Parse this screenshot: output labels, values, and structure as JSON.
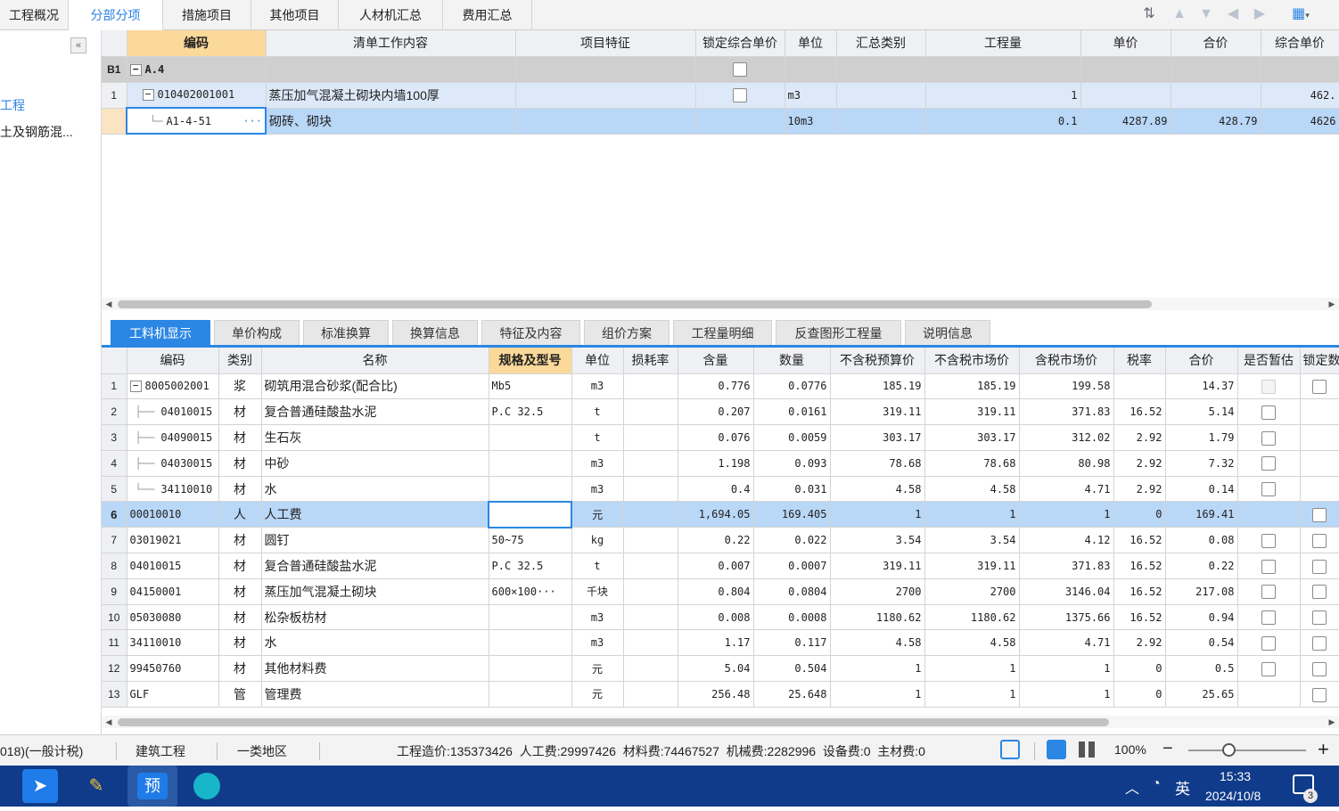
{
  "top_tabs": [
    "工程概况",
    "分部分项",
    "措施项目",
    "其他项目",
    "人材机汇总",
    "费用汇总"
  ],
  "active_top_tab": 1,
  "left_panel": {
    "items": [
      "工程",
      "土及钢筋混..."
    ]
  },
  "upper": {
    "headers": [
      "编码",
      "清单工作内容",
      "项目特征",
      "锁定综合单价",
      "单位",
      "汇总类别",
      "工程量",
      "单价",
      "合价",
      "综合单价"
    ],
    "rows": [
      {
        "num": "B1",
        "code": "A.4",
        "name": "",
        "feature": "",
        "lock": true,
        "unit": "",
        "cat": "",
        "qty": "",
        "price": "",
        "total": "",
        "comp": ""
      },
      {
        "num": "1",
        "code": "010402001001",
        "name": "蒸压加气混凝土砌块内墙100厚",
        "feature": "",
        "lock": true,
        "unit": "m3",
        "cat": "",
        "qty": "1",
        "price": "",
        "total": "",
        "comp": "462."
      },
      {
        "num": "",
        "code": "A1-4-51",
        "name": "砌砖、砌块",
        "feature": "",
        "lock": false,
        "unit": "10m3",
        "cat": "",
        "qty": "0.1",
        "price": "4287.89",
        "total": "428.79",
        "comp": "4626"
      }
    ],
    "ellipsis": "···"
  },
  "lower_tabs": [
    "工料机显示",
    "单价构成",
    "标准换算",
    "换算信息",
    "特征及内容",
    "组价方案",
    "工程量明细",
    "反查图形工程量",
    "说明信息"
  ],
  "active_lower_tab": 0,
  "lower": {
    "headers": [
      "编码",
      "类别",
      "名称",
      "规格及型号",
      "单位",
      "损耗率",
      "含量",
      "数量",
      "不含税预算价",
      "不含税市场价",
      "含税市场价",
      "税率",
      "合价",
      "是否暂估",
      "锁定数"
    ],
    "rows": [
      {
        "num": "1",
        "code": "8005002001",
        "type": "浆",
        "name": "砌筑用混合砂浆(配合比)",
        "spec": "Mb5",
        "unit": "m3",
        "loss": "",
        "content": "0.776",
        "qty": "0.0776",
        "p1": "185.19",
        "p2": "185.19",
        "p3": "199.58",
        "tax": "",
        "total": "14.37",
        "est": "dis",
        "lock": true
      },
      {
        "num": "2",
        "code": "04010015",
        "type": "材",
        "name": "复合普通硅酸盐水泥",
        "spec": "P.C 32.5",
        "unit": "t",
        "loss": "",
        "content": "0.207",
        "qty": "0.0161",
        "p1": "319.11",
        "p2": "319.11",
        "p3": "371.83",
        "tax": "16.52",
        "total": "5.14",
        "est": "on",
        "lock": false
      },
      {
        "num": "3",
        "code": "04090015",
        "type": "材",
        "name": "生石灰",
        "spec": "",
        "unit": "t",
        "loss": "",
        "content": "0.076",
        "qty": "0.0059",
        "p1": "303.17",
        "p2": "303.17",
        "p3": "312.02",
        "tax": "2.92",
        "total": "1.79",
        "est": "on",
        "lock": false
      },
      {
        "num": "4",
        "code": "04030015",
        "type": "材",
        "name": "中砂",
        "spec": "",
        "unit": "m3",
        "loss": "",
        "content": "1.198",
        "qty": "0.093",
        "p1": "78.68",
        "p2": "78.68",
        "p3": "80.98",
        "tax": "2.92",
        "total": "7.32",
        "est": "on",
        "lock": false
      },
      {
        "num": "5",
        "code": "34110010",
        "type": "材",
        "name": "水",
        "spec": "",
        "unit": "m3",
        "loss": "",
        "content": "0.4",
        "qty": "0.031",
        "p1": "4.58",
        "p2": "4.58",
        "p3": "4.71",
        "tax": "2.92",
        "total": "0.14",
        "est": "on",
        "lock": false
      },
      {
        "num": "6",
        "code": "00010010",
        "type": "人",
        "name": "人工费",
        "spec": "",
        "unit": "元",
        "loss": "",
        "content": "1,694.05",
        "qty": "169.405",
        "p1": "1",
        "p2": "1",
        "p3": "1",
        "tax": "0",
        "total": "169.41",
        "est": "",
        "lock": true
      },
      {
        "num": "7",
        "code": "03019021",
        "type": "材",
        "name": "圆钉",
        "spec": "50~75",
        "unit": "kg",
        "loss": "",
        "content": "0.22",
        "qty": "0.022",
        "p1": "3.54",
        "p2": "3.54",
        "p3": "4.12",
        "tax": "16.52",
        "total": "0.08",
        "est": "on",
        "lock": true
      },
      {
        "num": "8",
        "code": "04010015",
        "type": "材",
        "name": "复合普通硅酸盐水泥",
        "spec": "P.C 32.5",
        "unit": "t",
        "loss": "",
        "content": "0.007",
        "qty": "0.0007",
        "p1": "319.11",
        "p2": "319.11",
        "p3": "371.83",
        "tax": "16.52",
        "total": "0.22",
        "est": "on",
        "lock": true
      },
      {
        "num": "9",
        "code": "04150001",
        "type": "材",
        "name": "蒸压加气混凝土砌块",
        "spec": "600×100···",
        "unit": "千块",
        "loss": "",
        "content": "0.804",
        "qty": "0.0804",
        "p1": "2700",
        "p2": "2700",
        "p3": "3146.04",
        "tax": "16.52",
        "total": "217.08",
        "est": "on",
        "lock": true
      },
      {
        "num": "10",
        "code": "05030080",
        "type": "材",
        "name": "松杂板枋材",
        "spec": "",
        "unit": "m3",
        "loss": "",
        "content": "0.008",
        "qty": "0.0008",
        "p1": "1180.62",
        "p2": "1180.62",
        "p3": "1375.66",
        "tax": "16.52",
        "total": "0.94",
        "est": "on",
        "lock": true
      },
      {
        "num": "11",
        "code": "34110010",
        "type": "材",
        "name": "水",
        "spec": "",
        "unit": "m3",
        "loss": "",
        "content": "1.17",
        "qty": "0.117",
        "p1": "4.58",
        "p2": "4.58",
        "p3": "4.71",
        "tax": "2.92",
        "total": "0.54",
        "est": "on",
        "lock": true
      },
      {
        "num": "12",
        "code": "99450760",
        "type": "材",
        "name": "其他材料费",
        "spec": "",
        "unit": "元",
        "loss": "",
        "content": "5.04",
        "qty": "0.504",
        "p1": "1",
        "p2": "1",
        "p3": "1",
        "tax": "0",
        "total": "0.5",
        "est": "on",
        "lock": true
      },
      {
        "num": "13",
        "code": "GLF",
        "type": "管",
        "name": "管理费",
        "spec": "",
        "unit": "元",
        "loss": "",
        "content": "256.48",
        "qty": "25.648",
        "p1": "1",
        "p2": "1",
        "p3": "1",
        "tax": "0",
        "total": "25.65",
        "est": "",
        "lock": true
      }
    ]
  },
  "status": {
    "tax_mode": "018)(一般计税)",
    "project_type": "建筑工程",
    "region": "一类地区",
    "summary": "工程造价:135373426  人工费:29997426  材料费:74467527  机械费:2282996  设备费:0  主材费:0",
    "zoom": "100%",
    "zoom_level_pct": 62
  },
  "taskbar": {
    "ime": "英",
    "time": "15:33",
    "date": "2024/10/8",
    "notif": "3",
    "app_label": "预"
  }
}
